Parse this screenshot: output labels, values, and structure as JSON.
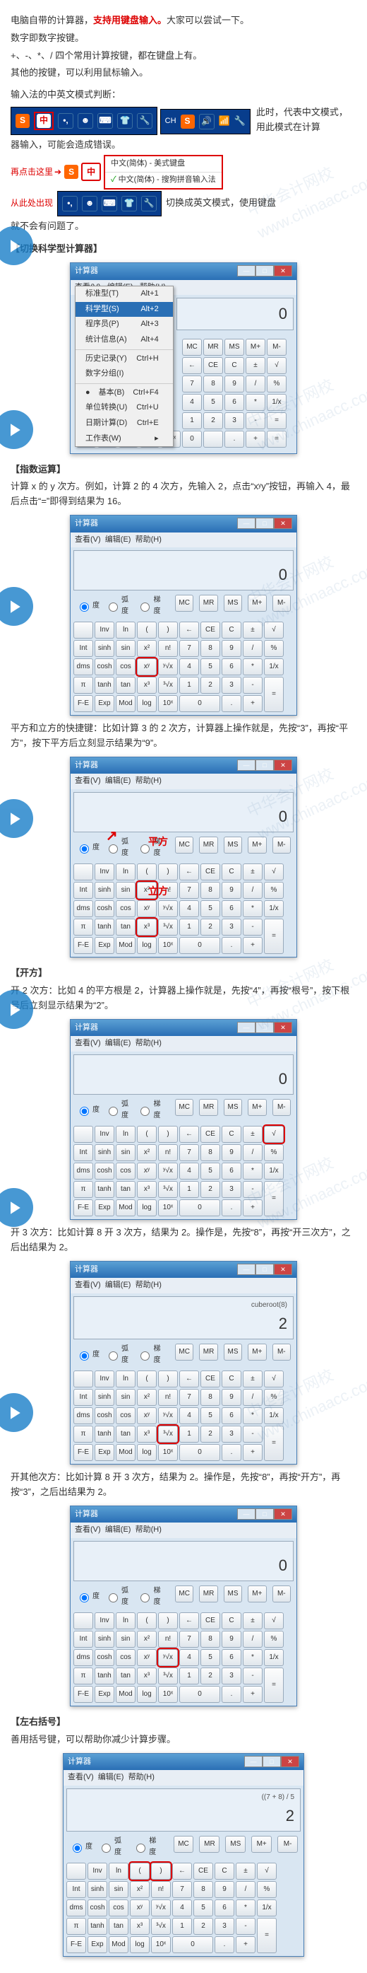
{
  "intro": {
    "l1a": "电脑自带的计算器，",
    "l1b": "支持用键盘输入。",
    "l1c": "大家可以尝试一下。",
    "l2": "数字即数字按键。",
    "l3": "+、-、*、/ 四个常用计算按键，都在键盘上有。",
    "l4": "其他的按键，可以利用鼠标输入。",
    "l5": "输入法的中英文模式判断：",
    "l6": "此时，代表中文模式，用此模式在计算",
    "l7": "器输入，可能会造成错误。",
    "l8": "再点击这里",
    "l9": "从此处出现",
    "ime_opt1": "中文(简体) - 美式键盘",
    "ime_opt2": "中文(简体) - 搜狗拼音输入法",
    "l10": "切换成英文模式，使用键盘",
    "l11": "就不会有问题了。"
  },
  "s1": {
    "title": "【切换科学型计算器】",
    "calc_title": "计算器",
    "menu1": "查看(V)",
    "menu2": "编辑(E)",
    "menu3": "帮助(H)",
    "dd": [
      {
        "l": "标准型(T)",
        "r": "Alt+1"
      },
      {
        "l": "科学型(S)",
        "r": "Alt+2",
        "hl": true
      },
      {
        "l": "程序员(P)",
        "r": "Alt+3"
      },
      {
        "l": "统计信息(A)",
        "r": "Alt+4"
      },
      {
        "l": "历史记录(Y)",
        "r": "Ctrl+H"
      },
      {
        "l": "数字分组(I)",
        "r": ""
      },
      {
        "l": "基本(B)",
        "r": "Ctrl+F4"
      },
      {
        "l": "单位转换(U)",
        "r": "Ctrl+U"
      },
      {
        "l": "日期计算(D)",
        "r": "Ctrl+E"
      },
      {
        "l": "工作表(W)",
        "r": ""
      }
    ],
    "disp": "0"
  },
  "s2": {
    "title": "【指数运算】",
    "text": "计算 x 的 y 次方。例如，计算 2 的 4 次方，先输入 2，点击“xʸy”按钮，再输入 4，最后点击“=”即得到结果为 16。",
    "disp": "0",
    "text2a": "平方和立方的快捷键：比如计算 3 的 2 次方，计算器上操作就是，先按“3”，再按“平方”，按下平方后立刻显示结果为“9”。",
    "disp2": "0",
    "lbl_sq": "平方",
    "lbl_cb": "立方"
  },
  "s3": {
    "title": "【开方】",
    "text1": "开 2 次方：比如 4 的平方根是 2，计算器上操作就是，先按“4”，再按“根号”，按下根号后立刻显示结果为“2”。",
    "disp1": "0",
    "text2": "开 3 次方：比如计算 8 开 3 次方，结果为 2。操作是，先按“8”，再按“开三次方”，之后出结果为 2。",
    "disp2_sm": "cuberoot(8)",
    "disp2": "2",
    "text3": "开其他次方：比如计算 8 开 3 次方，结果为 2。操作是，先按“8”，再按“开方”，再按“3”，之后出结果为 2。",
    "disp3": "0"
  },
  "s4": {
    "title": "【左右括号】",
    "text": "善用括号键，可以帮助你减少计算步骤。",
    "disp_sm": "((7 + 8) / 5",
    "disp": "2"
  },
  "radios": {
    "deg": "度",
    "rad": "弧度",
    "grad": "梯度"
  },
  "mem": [
    "MC",
    "MR",
    "MS",
    "M+",
    "M-"
  ],
  "sci_row1": [
    "",
    "Inv",
    "ln",
    "(",
    ")"
  ],
  "sci_row2": [
    "Int",
    "sinh",
    "sin",
    "x²",
    "n!"
  ],
  "sci_row3": [
    "dms",
    "cosh",
    "cos",
    "xʸ",
    "ʸ√x"
  ],
  "sci_row4": [
    "π",
    "tanh",
    "tan",
    "x³",
    "³√x"
  ],
  "sci_row5": [
    "F-E",
    "Exp",
    "Mod",
    "log",
    "10ˣ"
  ],
  "num_row1": [
    "←",
    "CE",
    "C",
    "±",
    "√"
  ],
  "num_row2": [
    "7",
    "8",
    "9",
    "/",
    "%"
  ],
  "num_row3": [
    "4",
    "5",
    "6",
    "*",
    "1/x"
  ],
  "num_row4": [
    "1",
    "2",
    "3",
    "-",
    "="
  ],
  "num_row5": [
    "0",
    ".",
    "+"
  ]
}
